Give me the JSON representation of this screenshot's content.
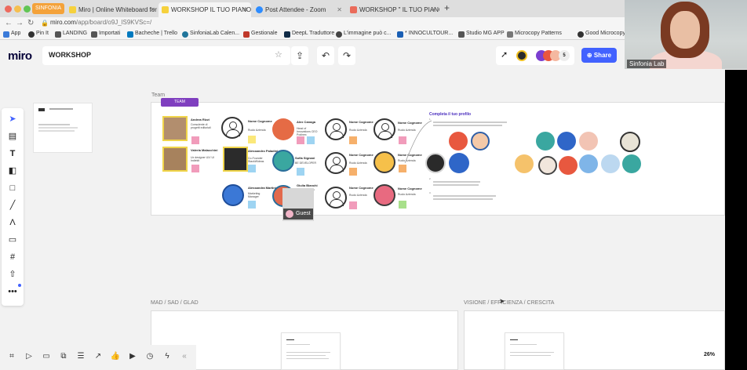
{
  "browser": {
    "tabs": [
      {
        "label": "SINFONIA"
      },
      {
        "label": "Miro | Online Whiteboard for V"
      },
      {
        "label": "WORKSHOP IL TUO PIANO DI"
      },
      {
        "label": "Post Attendee - Zoom"
      },
      {
        "label": "WORKSHOP \" IL TUO PIANO D"
      }
    ],
    "new_tab": "+",
    "url_host": "miro.com",
    "url_path": "/app/board/o9J_lS9KVSc=/",
    "bookmarks": [
      "App",
      "Pin It",
      "LANDING",
      "Importati",
      "Bacheche | Trello",
      "SinfoniaLab Calen...",
      "Gestionale",
      "DeepL Traduttore",
      "L'immagine può c...",
      "* INNOCULTOUR...",
      "Studio MG APP",
      "Microcopy Patterns",
      "Good Microcopy"
    ]
  },
  "miro": {
    "logo": "miro",
    "board_name": "WORKSHOP",
    "share_label": "Share",
    "collaborator_count": "5",
    "zoom": "26%"
  },
  "webcam": {
    "name": "Sinfonia Lab"
  },
  "board": {
    "team_label": "Team",
    "team_tag": "TEAM",
    "profile_title": "Completa il tuo profilo",
    "profile_step1": "1.",
    "profile_step2": "2.",
    "profile_step3": "3.",
    "guest_label": "Guest",
    "frame_mad": "MAD / SAD / GLAD",
    "frame_vision": "VISIONE / EFFICIENZA / CRESCITA",
    "members": [
      {
        "name": "Andrea Rizzi",
        "role": "Consulente di progetti editoriali"
      },
      {
        "name": "Valeria Malacchini",
        "role": "Ux designer UX/ UI Indiekit"
      },
      {
        "name": "Nome Cognome",
        "role": "Ruolo Azienda"
      },
      {
        "name": "Alessandro Paladini",
        "role": "Co-Founder StackWideas"
      },
      {
        "name": "Alessandra Martini",
        "role": "Marketing Manager"
      },
      {
        "name": "Alex Canaga",
        "role": "Head of Innovations CEO Podinex"
      },
      {
        "name": "Sofia Signani",
        "role": "BE DEVELOPER"
      },
      {
        "name": "Giulia Bianchi",
        "role": "Ruolo Azienda"
      },
      {
        "name": "Nome Cognome",
        "role": "Ruolo Azienda"
      },
      {
        "name": "Nome Cognome",
        "role": "Ruolo Azienda"
      },
      {
        "name": "Nome Cognome",
        "role": "Ruolo Azienda"
      },
      {
        "name": "Nome Cognome",
        "role": "Ruolo Azienda"
      },
      {
        "name": "Nome Cognome",
        "role": "Ruolo Azienda"
      },
      {
        "name": "Nome Cognome",
        "role": "Ruolo Azienda"
      }
    ]
  },
  "colors": {
    "miro_blue": "#4262ff",
    "team_tag": "#7f3fbf",
    "sinfonia_orange": "#f4a23a"
  },
  "icons": {
    "left_tools": [
      "select-icon",
      "template-icon",
      "text-icon",
      "sticky-note-icon",
      "shape-icon",
      "pen-icon",
      "marker-icon",
      "comment-icon",
      "frame-icon",
      "upload-icon",
      "more-icon"
    ],
    "bottom_tools": [
      "frames-icon",
      "present-icon",
      "chat-icon",
      "screen-share-icon",
      "cards-icon",
      "export-icon",
      "reaction-icon",
      "video-icon",
      "timer-icon",
      "bolt-icon",
      "collapse-icon"
    ]
  }
}
